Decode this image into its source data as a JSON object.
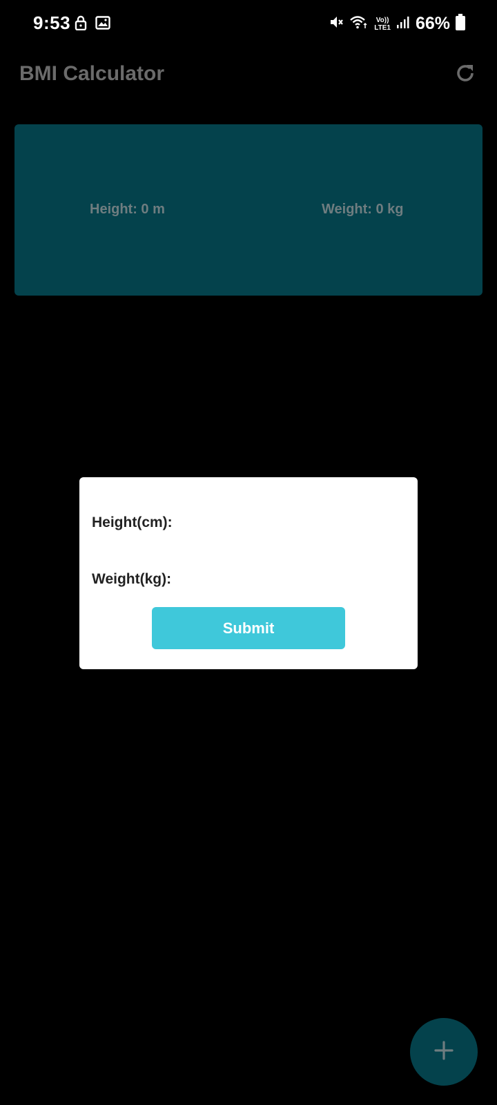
{
  "status_bar": {
    "time": "9:53",
    "left_icons": [
      "lock-icon",
      "image-icon"
    ],
    "right_icons": [
      "mute-icon",
      "wifi-icon",
      "volte-icon",
      "signal-icon",
      "battery-icon"
    ],
    "volte_top": "Vo))",
    "volte_bottom": "LTE1",
    "battery": "66%"
  },
  "app_bar": {
    "title": "BMI Calculator",
    "action_icon": "refresh-icon"
  },
  "info_card": {
    "height_text": "Height: 0 m",
    "weight_text": "Weight: 0 kg",
    "background": "#04424c"
  },
  "dialog": {
    "height_label": "Height(cm):",
    "weight_label": "Weight(kg):",
    "submit_label": "Submit",
    "submit_color": "#3fc8da"
  },
  "fab": {
    "icon": "plus-icon",
    "background": "#04424c"
  }
}
